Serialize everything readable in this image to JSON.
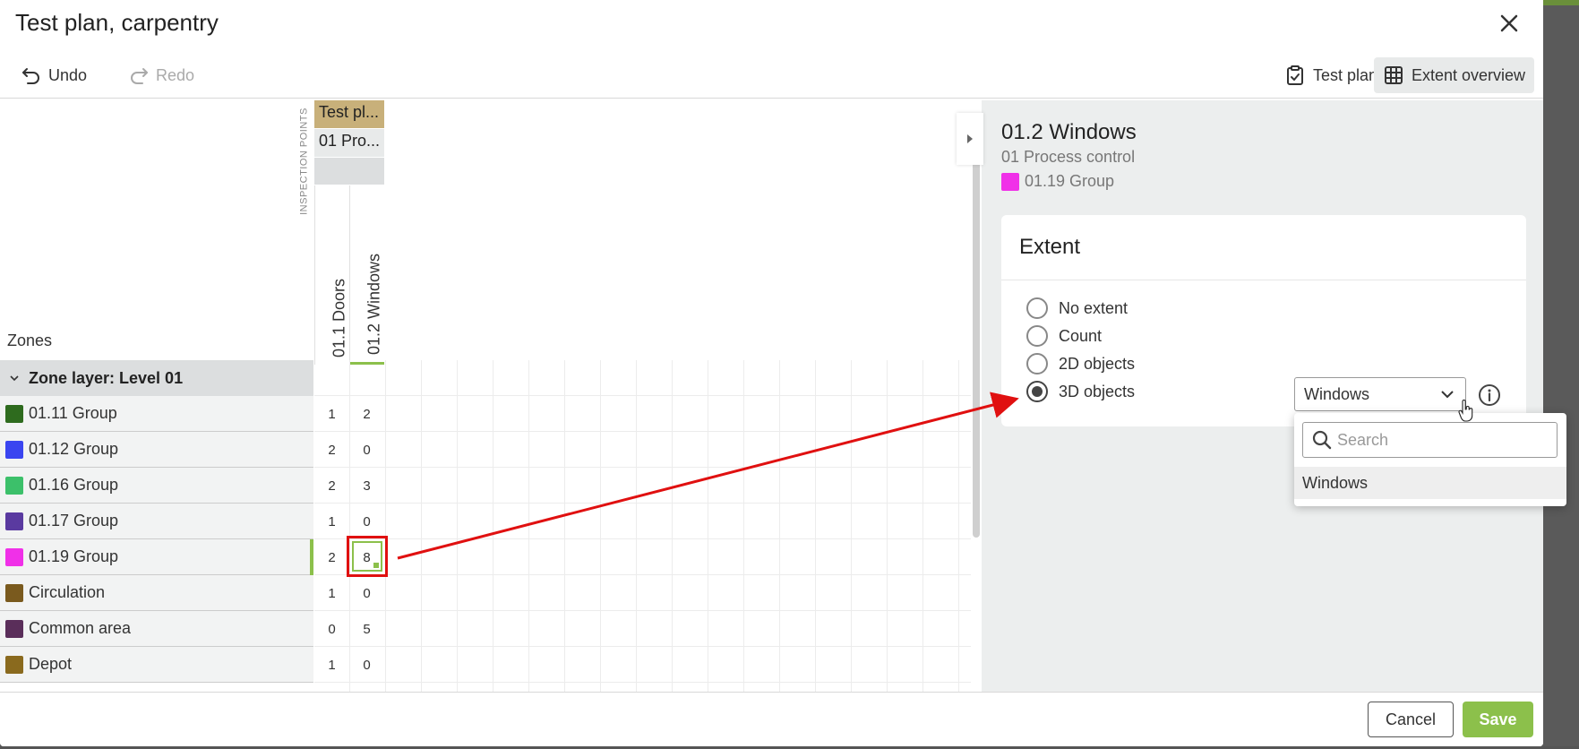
{
  "modal": {
    "title": "Test plan, carpentry"
  },
  "toolbar": {
    "undo_label": "Undo",
    "redo_label": "Redo",
    "test_plan_label": "Test plan",
    "extent_overview_label": "Extent overview"
  },
  "grid": {
    "zones_label": "Zones",
    "inspection_points_label": "INSPECTION POINTS",
    "header_test_plan": "Test pl...",
    "header_process": "01 Pro...",
    "columns": [
      "01.1 Doors",
      "01.2 Windows"
    ],
    "zone_layer": "Zone layer: Level 01",
    "rows": [
      {
        "name": "01.11 Group",
        "color": "#2e6b1e",
        "values": [
          "1",
          "2"
        ]
      },
      {
        "name": "01.12 Group",
        "color": "#3a45f0",
        "values": [
          "2",
          "0"
        ]
      },
      {
        "name": "01.16 Group",
        "color": "#3cc06a",
        "values": [
          "2",
          "3"
        ]
      },
      {
        "name": "01.17 Group",
        "color": "#5a3aa0",
        "values": [
          "1",
          "0"
        ]
      },
      {
        "name": "01.19 Group",
        "color": "#f030e8",
        "values": [
          "2",
          "8"
        ]
      },
      {
        "name": "Circulation",
        "color": "#7a5a1e",
        "values": [
          "1",
          "0"
        ]
      },
      {
        "name": "Common area",
        "color": "#5a2e5a",
        "values": [
          "0",
          "5"
        ]
      },
      {
        "name": "Depot",
        "color": "#8a6a1e",
        "values": [
          "1",
          "0"
        ]
      }
    ]
  },
  "detail": {
    "title": "01.2 Windows",
    "subtitle": "01 Process control",
    "zone_name": "01.19 Group",
    "zone_color": "#f030e8"
  },
  "extent": {
    "title": "Extent",
    "options": [
      "No extent",
      "Count",
      "2D objects",
      "3D objects"
    ],
    "selected": "3D objects",
    "select_value": "Windows",
    "search_placeholder": "Search",
    "dropdown_items": [
      "Windows"
    ]
  },
  "footer": {
    "cancel_label": "Cancel",
    "save_label": "Save"
  },
  "colors": {
    "accent": "#8cc04b",
    "highlight": "#e01010"
  }
}
